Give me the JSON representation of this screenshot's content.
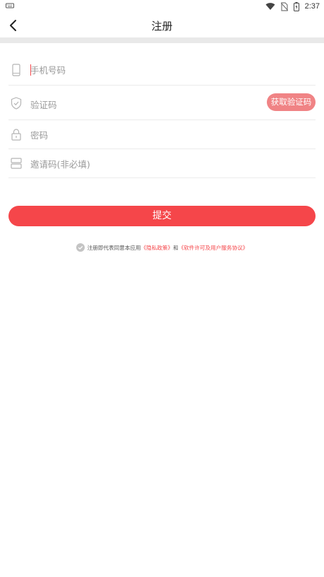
{
  "status_bar": {
    "time": "2:37"
  },
  "header": {
    "title": "注册"
  },
  "form": {
    "phone_placeholder": "手机号码",
    "code_placeholder": "验证码",
    "get_code_label": "获取验证码",
    "password_placeholder": "密码",
    "invite_placeholder": "邀请码(非必填)"
  },
  "submit_label": "提交",
  "agreement": {
    "prefix": "注册即代表同意本应用",
    "privacy_link": "《隐私政策》",
    "conjunction": "和",
    "terms_link": "《软件许可及用户服务协议》"
  },
  "colors": {
    "accent": "#f5464a",
    "accent_light": "#f08385",
    "divider": "#ebebeb"
  },
  "icons": [
    "keyboard-icon",
    "wifi-icon",
    "no-sim-icon",
    "battery-icon",
    "back-arrow-icon",
    "phone-icon",
    "shield-icon",
    "lock-icon",
    "ticket-icon",
    "check-circle-icon"
  ]
}
